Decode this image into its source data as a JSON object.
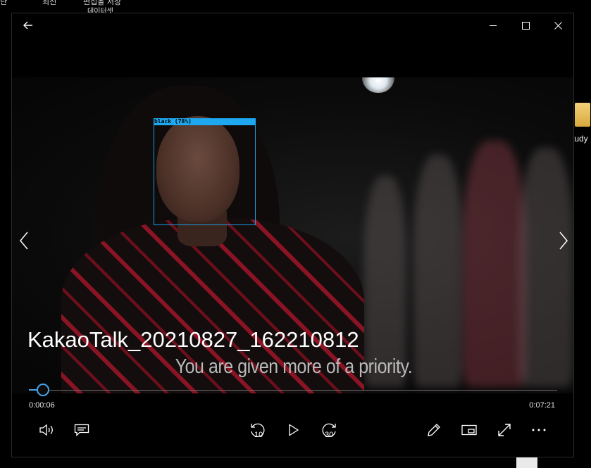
{
  "desktop": {
    "top_labels": [
      "난",
      "최신",
      "편집을 저장",
      "데이터셋"
    ],
    "folder_label": "tudy"
  },
  "window": {
    "back_icon": "back-arrow-icon",
    "minimize_icon": "minimize-icon",
    "maximize_icon": "maximize-icon",
    "close_icon": "close-icon"
  },
  "video": {
    "detection_label": "black (78%)",
    "subtitle": "You are given more of a priority.",
    "prev_icon": "chevron-left-icon",
    "next_icon": "chevron-right-icon"
  },
  "file_title": "KakaoTalk_20210827_162210812",
  "playback": {
    "elapsed": "0:00:06",
    "total": "0:07:21",
    "progress_fraction": 0.0136,
    "accent_color": "#4aa3ea"
  },
  "controls": {
    "volume_icon": "volume-icon",
    "captions_icon": "captions-icon",
    "skip_back_label": "10",
    "play_icon": "play-icon",
    "skip_forward_label": "30",
    "edit_icon": "pencil-icon",
    "mini_view_icon": "mini-view-icon",
    "fullscreen_icon": "fullscreen-icon",
    "more_icon": "more-options-icon"
  }
}
